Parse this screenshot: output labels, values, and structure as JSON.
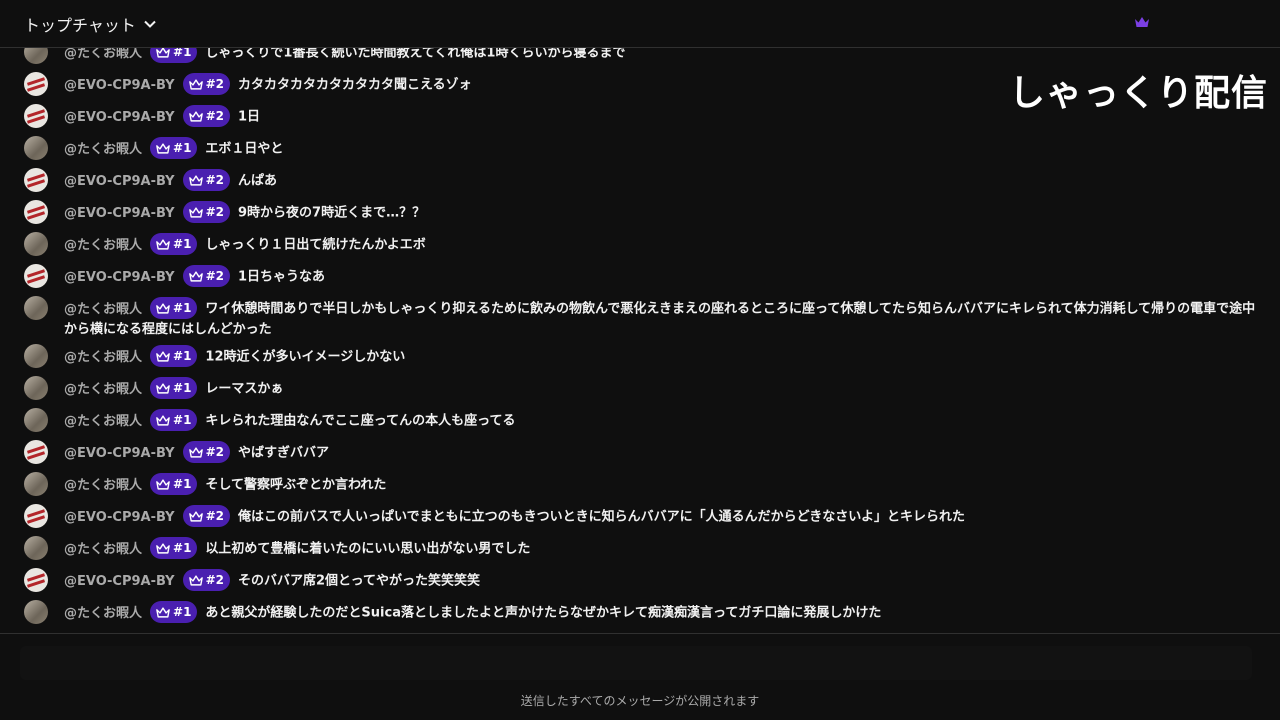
{
  "header": {
    "title": "トップチャット",
    "chevron_icon": "chevron-down-icon",
    "crown_icon": "crown-icon",
    "accent": "#7b3fe4"
  },
  "overlay": {
    "title": "しゃっくり配信"
  },
  "messages": [
    {
      "avatar": "a1",
      "author": "@たくお暇人",
      "badge": "#1",
      "text": "しゃっくりで1番長く続いた時間教えてくれ俺は1時くらいから寝るまで"
    },
    {
      "avatar": "a2",
      "author": "@EVO-CP9A-BY",
      "badge": "#2",
      "text": "カタカタカタカタカタカタ聞こえるゾォ"
    },
    {
      "avatar": "a2",
      "author": "@EVO-CP9A-BY",
      "badge": "#2",
      "text": "1日"
    },
    {
      "avatar": "a1",
      "author": "@たくお暇人",
      "badge": "#1",
      "text": "エボ１日やと"
    },
    {
      "avatar": "a2",
      "author": "@EVO-CP9A-BY",
      "badge": "#2",
      "text": "んぱあ"
    },
    {
      "avatar": "a2",
      "author": "@EVO-CP9A-BY",
      "badge": "#2",
      "text": "9時から夜の7時近くまで…？？"
    },
    {
      "avatar": "a1",
      "author": "@たくお暇人",
      "badge": "#1",
      "text": "しゃっくり１日出て続けたんかよエボ"
    },
    {
      "avatar": "a2",
      "author": "@EVO-CP9A-BY",
      "badge": "#2",
      "text": "1日ちゃうなあ"
    },
    {
      "avatar": "a1",
      "author": "@たくお暇人",
      "badge": "#1",
      "text": "ワイ休憩時間ありで半日しかもしゃっくり抑えるために飲みの物飲んで悪化えきまえの座れるところに座って休憩してたら知らんババアにキレられて体力消耗して帰りの電車で途中から横になる程度にはしんどかった",
      "tall": true
    },
    {
      "avatar": "a1",
      "author": "@たくお暇人",
      "badge": "#1",
      "text": "12時近くが多いイメージしかない"
    },
    {
      "avatar": "a1",
      "author": "@たくお暇人",
      "badge": "#1",
      "text": "レーマスかぁ"
    },
    {
      "avatar": "a1",
      "author": "@たくお暇人",
      "badge": "#1",
      "text": "キレられた理由なんでここ座ってんの本人も座ってる"
    },
    {
      "avatar": "a2",
      "author": "@EVO-CP9A-BY",
      "badge": "#2",
      "text": "やばすぎババア"
    },
    {
      "avatar": "a1",
      "author": "@たくお暇人",
      "badge": "#1",
      "text": "そして警察呼ぶぞとか言われた"
    },
    {
      "avatar": "a2",
      "author": "@EVO-CP9A-BY",
      "badge": "#2",
      "text": "俺はこの前バスで人いっぱいでまともに立つのもきついときに知らんババアに「人通るんだからどきなさいよ」とキレられた"
    },
    {
      "avatar": "a1",
      "author": "@たくお暇人",
      "badge": "#1",
      "text": "以上初めて豊橋に着いたのにいい思い出がない男でした"
    },
    {
      "avatar": "a2",
      "author": "@EVO-CP9A-BY",
      "badge": "#2",
      "text": "そのババア席2個とってやがった笑笑笑笑"
    },
    {
      "avatar": "a1",
      "author": "@たくお暇人",
      "badge": "#1",
      "text": "あと親父が経験したのだとSuica落としましたよと声かけたらなぜかキレて痴漢痴漢言ってガチ口論に発展しかけた"
    }
  ],
  "footer": {
    "notice": "送信したすべてのメッセージが公開されます"
  }
}
